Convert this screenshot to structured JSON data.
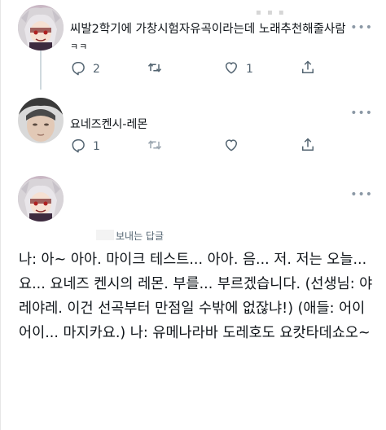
{
  "posts": [
    {
      "text_line1": "씨발2학기에 가창시험자유곡이라는데 노래추천해줄사람",
      "text_line2": "ㅋㅋ",
      "reply_count": "2",
      "retweet_count": "",
      "like_count": "1",
      "more": "•••"
    },
    {
      "name": "요네즈켄시-레몬",
      "reply_count": "1",
      "more": "•••"
    },
    {
      "more": "•••"
    }
  ],
  "reply": {
    "label": "보내는 답글",
    "body": "나: 아~ 아아. 마이크 테스트... 아아. 음... 저. 저는 오늘... 요... 요네즈 켄시의 레몬. 부를... 부르겠습니다. (선생님: 야레야레. 이건 선곡부터 만점일 수밖에 없잖냐!) (애들: 어이어이... 마지카요.) 나: 유메나라바 도레호도 요캇타데쇼오~"
  },
  "icons": {
    "reply": "reply-icon",
    "retweet": "retweet-icon",
    "like": "heart-icon",
    "share": "share-icon"
  },
  "colors": {
    "icon": "#536471",
    "text": "#0f1419",
    "thread_line": "#cfd9de"
  }
}
